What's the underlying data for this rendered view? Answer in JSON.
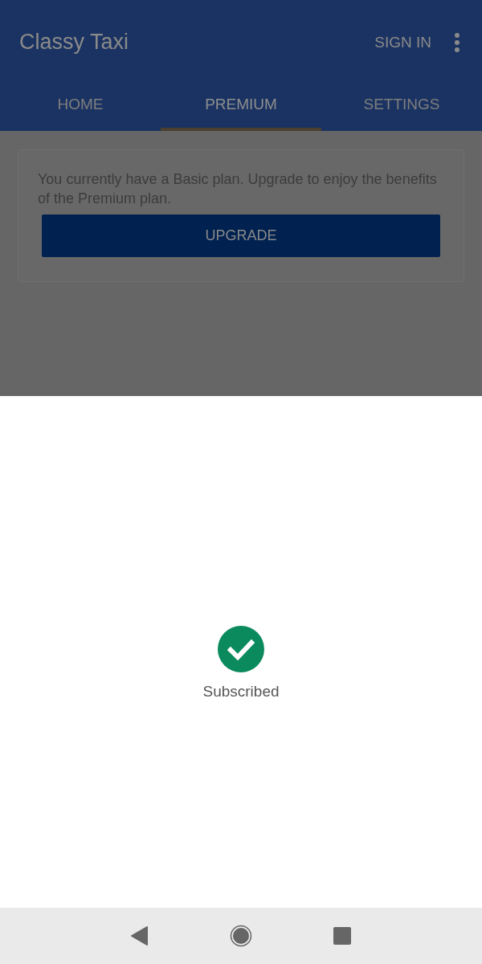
{
  "app_bar": {
    "title": "Classy Taxi",
    "action": "SIGN IN"
  },
  "tabs": [
    {
      "label": "HOME",
      "selected": false
    },
    {
      "label": "PREMIUM",
      "selected": true
    },
    {
      "label": "SETTINGS",
      "selected": false
    }
  ],
  "card": {
    "message": "You currently have a Basic plan. Upgrade to enjoy the benefits of the Premium plan.",
    "button": "UPGRADE"
  },
  "sheet": {
    "status": "Subscribed"
  }
}
